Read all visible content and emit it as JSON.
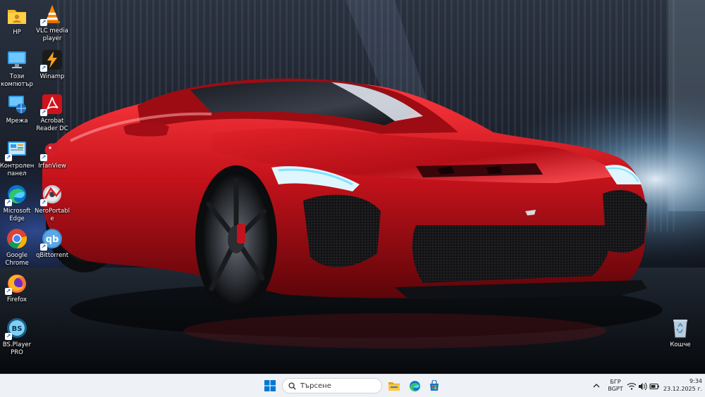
{
  "desktop": {
    "icons": [
      {
        "label": "HP",
        "icon": "user-folder-icon"
      },
      {
        "label": "VLC media player",
        "icon": "vlc-cone-icon"
      },
      {
        "label": "Този компютър",
        "icon": "monitor-icon"
      },
      {
        "label": "Winamp",
        "icon": "winamp-bolt-icon"
      },
      {
        "label": "Мрежа",
        "icon": "network-icon"
      },
      {
        "label": "Acrobat Reader DC",
        "icon": "acrobat-icon"
      },
      {
        "label": "Контролен панел",
        "icon": "control-panel-icon"
      },
      {
        "label": "IrfanView",
        "icon": "irfanview-icon"
      },
      {
        "label": "Microsoft Edge",
        "icon": "edge-icon"
      },
      {
        "label": "NeroPortable",
        "icon": "nero-icon"
      },
      {
        "label": "Google Chrome",
        "icon": "chrome-icon"
      },
      {
        "label": "qBittorrent",
        "icon": "qbittorrent-icon"
      },
      {
        "label": "Firefox",
        "icon": "firefox-icon"
      },
      {
        "label": "BS.Player PRO",
        "icon": "bsplayer-icon"
      },
      {
        "label": "Кошче",
        "icon": "recycle-bin-icon"
      }
    ]
  },
  "taskbar": {
    "search_placeholder": "Търсене",
    "pinned": [
      "file-explorer-icon",
      "edge-icon",
      "microsoft-store-icon"
    ],
    "language_top": "БГР",
    "language_bottom": "BGPT",
    "time": "9:34",
    "date": "23.12.2025 г."
  },
  "colors": {
    "car_red": "#c4121b",
    "taskbar_bg": "#eef1f6",
    "windows_blue": "#0078d4"
  }
}
